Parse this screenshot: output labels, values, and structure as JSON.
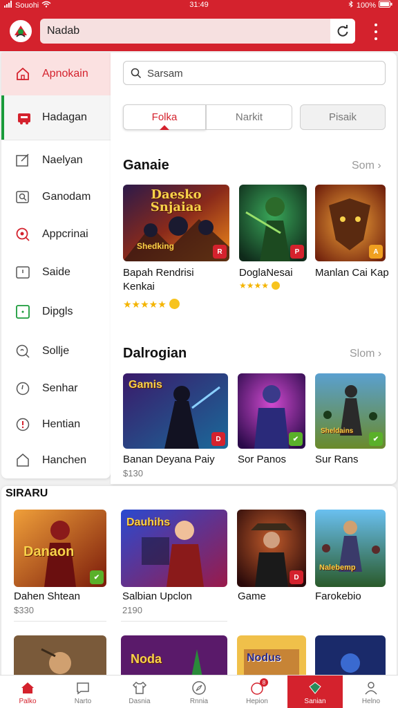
{
  "status": {
    "carrier": "Souohi",
    "time": "31:49",
    "battery": "100%"
  },
  "appbar": {
    "url": "Nadab"
  },
  "sidebar": {
    "items": [
      {
        "label": "Apnokain"
      },
      {
        "label": "Hadagan"
      },
      {
        "label": "Naelyan"
      },
      {
        "label": "Ganodam"
      },
      {
        "label": "Appcrinai"
      },
      {
        "label": "Saide"
      },
      {
        "label": "Dipgls"
      },
      {
        "label": "Sollje"
      },
      {
        "label": "Senhar"
      },
      {
        "label": "Hentian"
      },
      {
        "label": "Hanchen"
      }
    ]
  },
  "main": {
    "search_placeholder": "Sarsam",
    "tabs": [
      {
        "label": "Folka"
      },
      {
        "label": "Narkit"
      },
      {
        "label": "Pisaik"
      }
    ],
    "section1": {
      "title": "Ganaie",
      "see_more": "Som ›",
      "items": [
        {
          "name": "Bapah Rendrisi",
          "name2": "Kenkai",
          "rating": "★★★★★",
          "badge": "R",
          "art": "Daesko Snjaiaa",
          "art2": "Shedking"
        },
        {
          "name": "DoglaNesai",
          "rating": "★★★★",
          "badge": "P"
        },
        {
          "name": "Manlan Cai Kap",
          "badge": "A"
        }
      ]
    },
    "section2": {
      "title": "Dalrogian",
      "see_more": "Slom ›",
      "items": [
        {
          "name": "Banan Deyana Paiy",
          "sub": "$130",
          "badge": "D",
          "art": "Gamis"
        },
        {
          "name": "Sor Panos",
          "badge": "✔"
        },
        {
          "name": "Sur Rans",
          "badge": "✔",
          "art": "Sheldains"
        }
      ]
    }
  },
  "bottom": {
    "title": "SIRARU",
    "items": [
      {
        "name": "Dahen Shtean",
        "sub": "$330",
        "badge": "✔",
        "art": "Danaon"
      },
      {
        "name": "Salbian Upclon",
        "sub": "2190",
        "art": "Dauhihs"
      },
      {
        "name": "Game",
        "badge": "D"
      },
      {
        "name": "Farokebio",
        "art": "Nalebemp"
      }
    ],
    "row2_art": [
      "",
      "Noda",
      "Nodus",
      ""
    ]
  },
  "bottomnav": {
    "items": [
      {
        "label": "Palko"
      },
      {
        "label": "Narto"
      },
      {
        "label": "Dasnia"
      },
      {
        "label": "Rnnia"
      },
      {
        "label": "Hepion",
        "badge": "8"
      },
      {
        "label": "Sanian"
      },
      {
        "label": "Helno"
      }
    ]
  },
  "colors": {
    "primary": "#d4222d",
    "accent_green": "#1a9b3a",
    "star": "#f4b400"
  }
}
